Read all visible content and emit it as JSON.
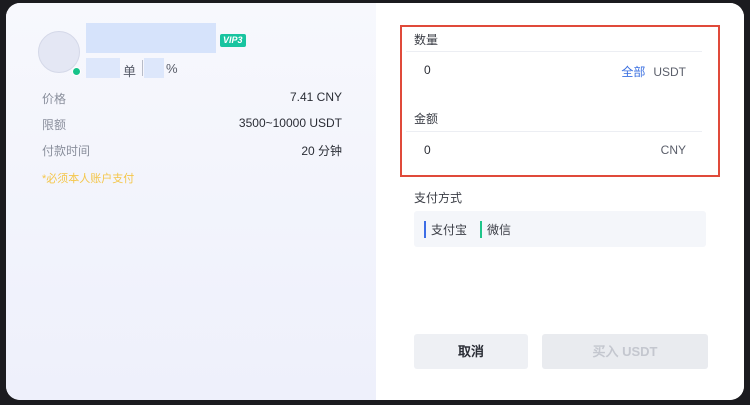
{
  "merchant": {
    "vip_badge": "VIP3",
    "orders_unit": "单",
    "rate_unit": "%"
  },
  "info": [
    {
      "label": "价格",
      "value": "7.41 CNY"
    },
    {
      "label": "限额",
      "value": "3500~10000 USDT"
    },
    {
      "label": "付款时间",
      "value": "20 分钟"
    }
  ],
  "note": "*必须本人账户支付",
  "form": {
    "quantity": {
      "label": "数量",
      "value": "0",
      "all_label": "全部",
      "unit": "USDT"
    },
    "amount": {
      "label": "金额",
      "value": "0",
      "unit": "CNY"
    }
  },
  "payment": {
    "label": "支付方式",
    "methods": [
      "支付宝",
      "微信"
    ]
  },
  "buttons": {
    "cancel": "取消",
    "buy": "买入 USDT"
  },
  "colors": {
    "highlight_border": "#e04a3a",
    "vip_badge": "#18c4a0",
    "alipay": "#3d6de6",
    "wechat": "#1fc58a",
    "note": "#f4c64a"
  }
}
